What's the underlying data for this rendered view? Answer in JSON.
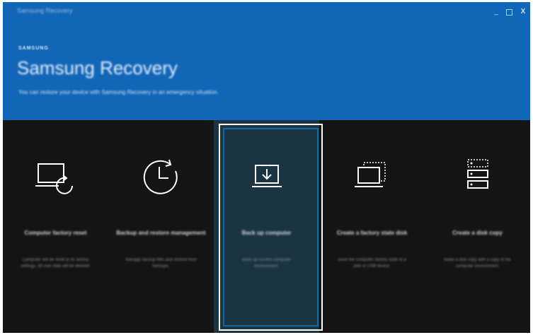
{
  "window": {
    "title": "Samsung Recovery",
    "controls": {
      "minimize": "_",
      "close": "X"
    }
  },
  "header": {
    "brand": "SAMSUNG",
    "app_name": "Samsung Recovery",
    "tagline": "You can restore your device with Samsung Recovery in an emergency situation."
  },
  "tiles": [
    {
      "icon": "computer-factory-reset-icon",
      "title": "Computer factory reset",
      "description": "Computer will be reset to its factory settings. All user data will be deleted."
    },
    {
      "icon": "backup-restore-clock-icon",
      "title": "Backup and restore management",
      "description": "Manage backup files and restore from backups."
    },
    {
      "icon": "download-laptop-icon",
      "title": "Back up computer",
      "description": "Back up current computer environment.",
      "selected": true
    },
    {
      "icon": "factory-image-icon",
      "title": "Create a factory state disk",
      "description": "Save the computer factory state to a disk or USB device."
    },
    {
      "icon": "disk-copy-icon",
      "title": "Create a disk copy",
      "description": "Make a disk copy with a copy of the computer environment."
    }
  ],
  "colors": {
    "header_blue": "#1266b8",
    "body_dark": "#141414",
    "selected_tile": "#1a3442",
    "selection_border": "#0f6aa6"
  }
}
